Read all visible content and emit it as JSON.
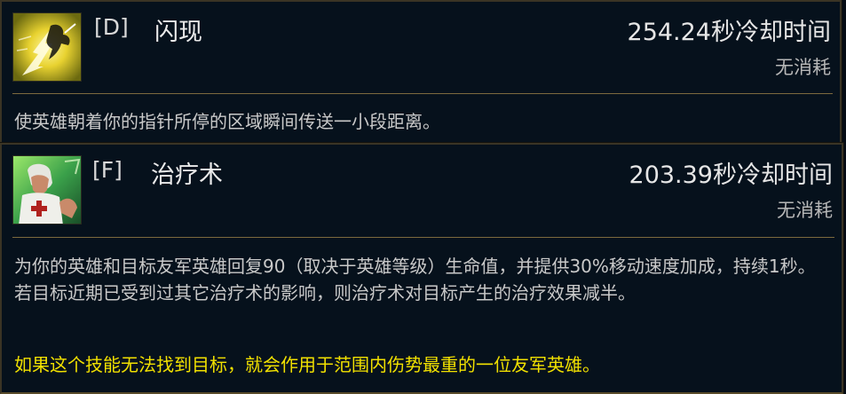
{
  "summoner_spells": [
    {
      "key": "[D]",
      "name": "闪现",
      "cooldown": "254.24秒冷却时间",
      "cost": "无消耗",
      "description": "使英雄朝着你的指针所停的区域瞬间传送一小段距离。",
      "icon": "flash-icon"
    },
    {
      "key": "[F]",
      "name": "治疗术",
      "cooldown": "203.39秒冷却时间",
      "cost": "无消耗",
      "description": "为你的英雄和目标友军英雄回复90（取决于英雄等级）生命值，并提供30%移动速度加成，持续1秒。若目标近期已受到过其它治疗术的影响，则治疗术对目标产生的治疗效果减半。",
      "note": "如果这个技能无法找到目标，就会作用于范围内伤势最重的一位友军英雄。",
      "icon": "heal-icon"
    }
  ],
  "colors": {
    "background": "#06111c",
    "border": "#3a3425",
    "divider": "#7c6a3e",
    "note_text": "#f2e100"
  }
}
